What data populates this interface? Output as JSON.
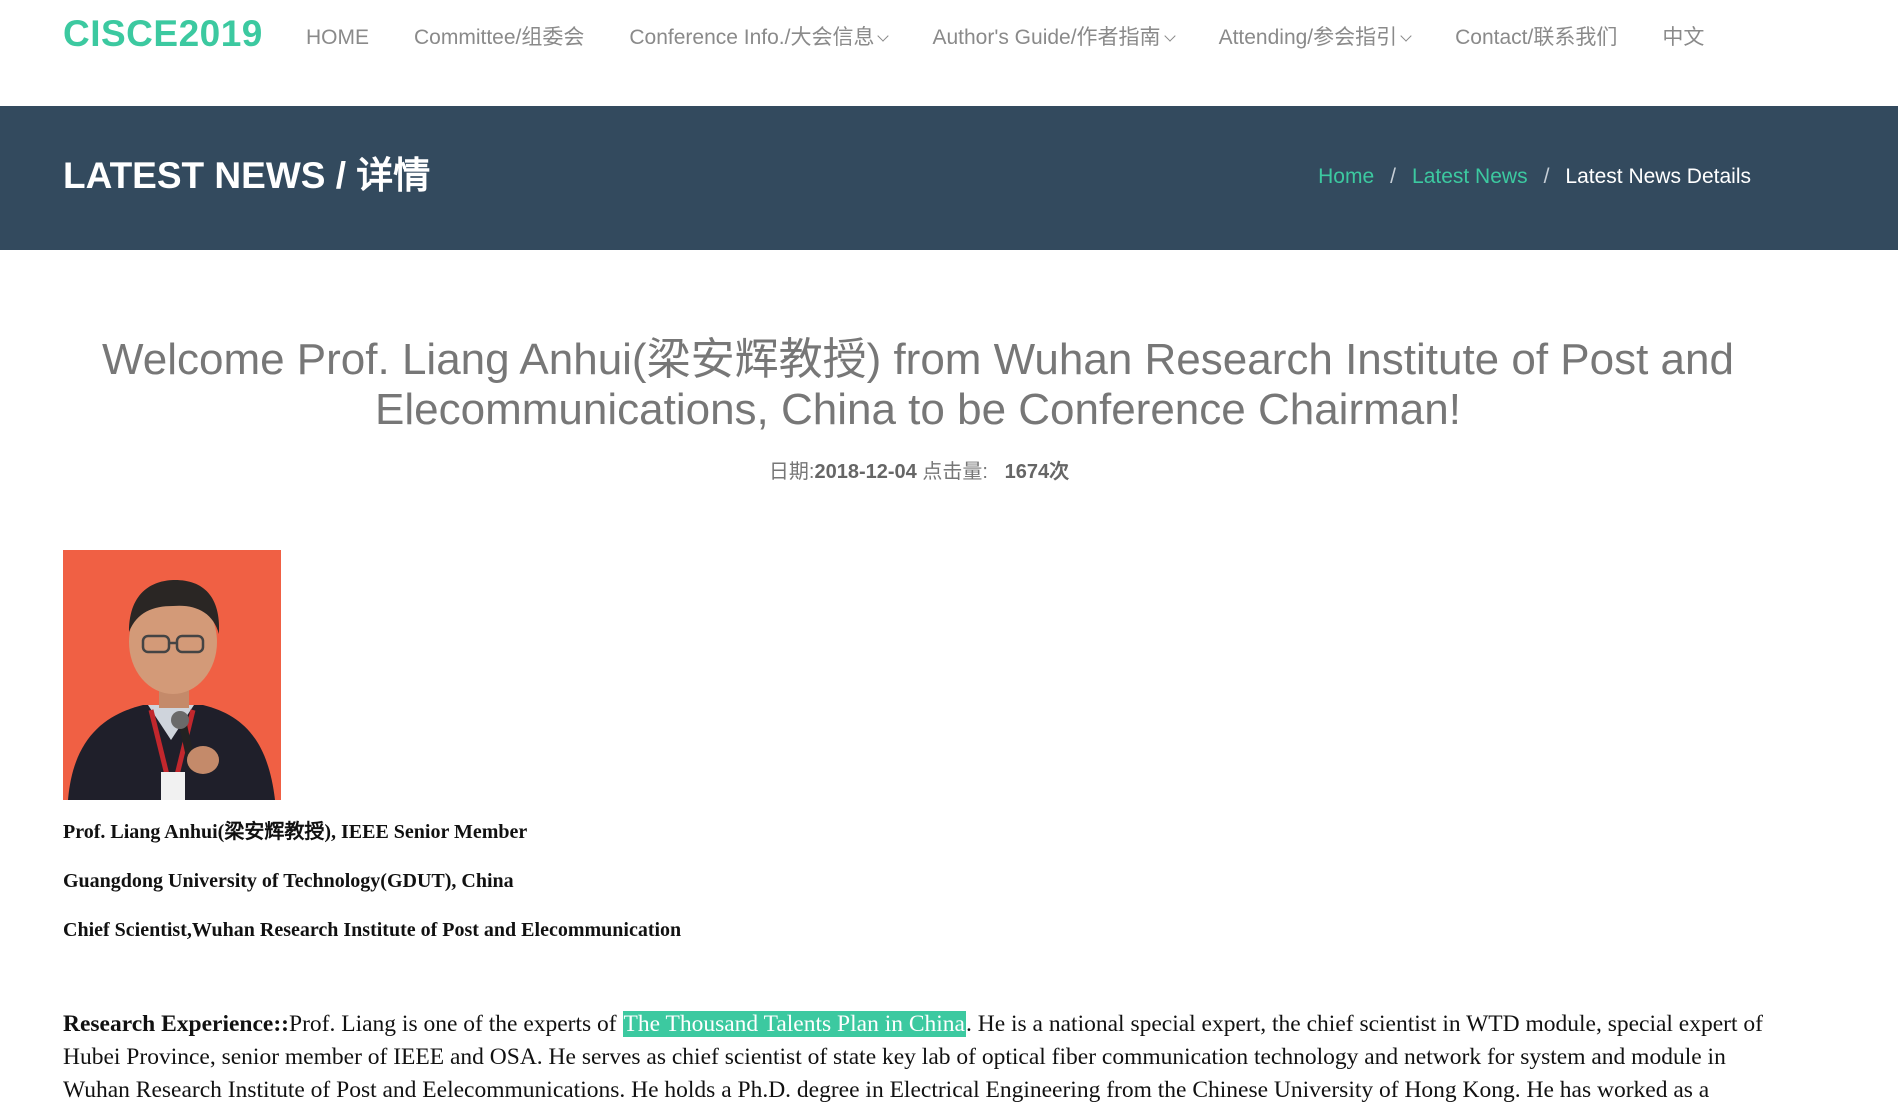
{
  "header": {
    "brand": "CISCE2019",
    "nav": [
      {
        "label": "HOME",
        "dropdown": false
      },
      {
        "label": "Committee/组委会",
        "dropdown": false
      },
      {
        "label": "Conference Info./大会信息",
        "dropdown": true
      },
      {
        "label": "Author's Guide/作者指南",
        "dropdown": true
      },
      {
        "label": "Attending/参会指引",
        "dropdown": true
      },
      {
        "label": "Contact/联系我们",
        "dropdown": false
      },
      {
        "label": "中文",
        "dropdown": false
      }
    ]
  },
  "banner": {
    "title": "LATEST NEWS / 详情",
    "breadcrumb": {
      "home": "Home",
      "sep": "/",
      "section": "Latest News",
      "current": "Latest News Details"
    }
  },
  "article": {
    "title": "Welcome Prof. Liang Anhui(梁安辉教授) from Wuhan Research Institute of Post and Elecommunications, China to be Conference Chairman!",
    "meta": {
      "date_label": "日期:",
      "date": "2018-12-04",
      "views_label": "点击量:",
      "views": "1674次"
    },
    "photo_alt": "Prof. Liang Anhui",
    "info": [
      "Prof. Liang Anhui(梁安辉教授), IEEE Senior Member",
      "Guangdong University of Technology(GDUT), China",
      "Chief Scientist,Wuhan Research Institute of Post and Elecommunication"
    ],
    "research": {
      "label": "Research Experience::",
      "before": "Prof. Liang is one of the experts of ",
      "highlight": "The Thousand Talents Plan in China",
      "after": ". He is a national special expert, the chief scientist in WTD module, special expert of Hubei Province, senior member of IEEE and OSA. He serves as chief scientist of state key lab of optical fiber communication technology and network for system and module in Wuhan Research Institute of Post and Eelecommunications. He holds a Ph.D. degree in Electrical Engineering from the Chinese University of Hong Kong. He has worked as a"
    }
  },
  "colors": {
    "accent": "#3cc9a0",
    "banner_bg": "#334a5e",
    "nav_text": "#8a8a8a",
    "photo_bg": "#f06044"
  }
}
